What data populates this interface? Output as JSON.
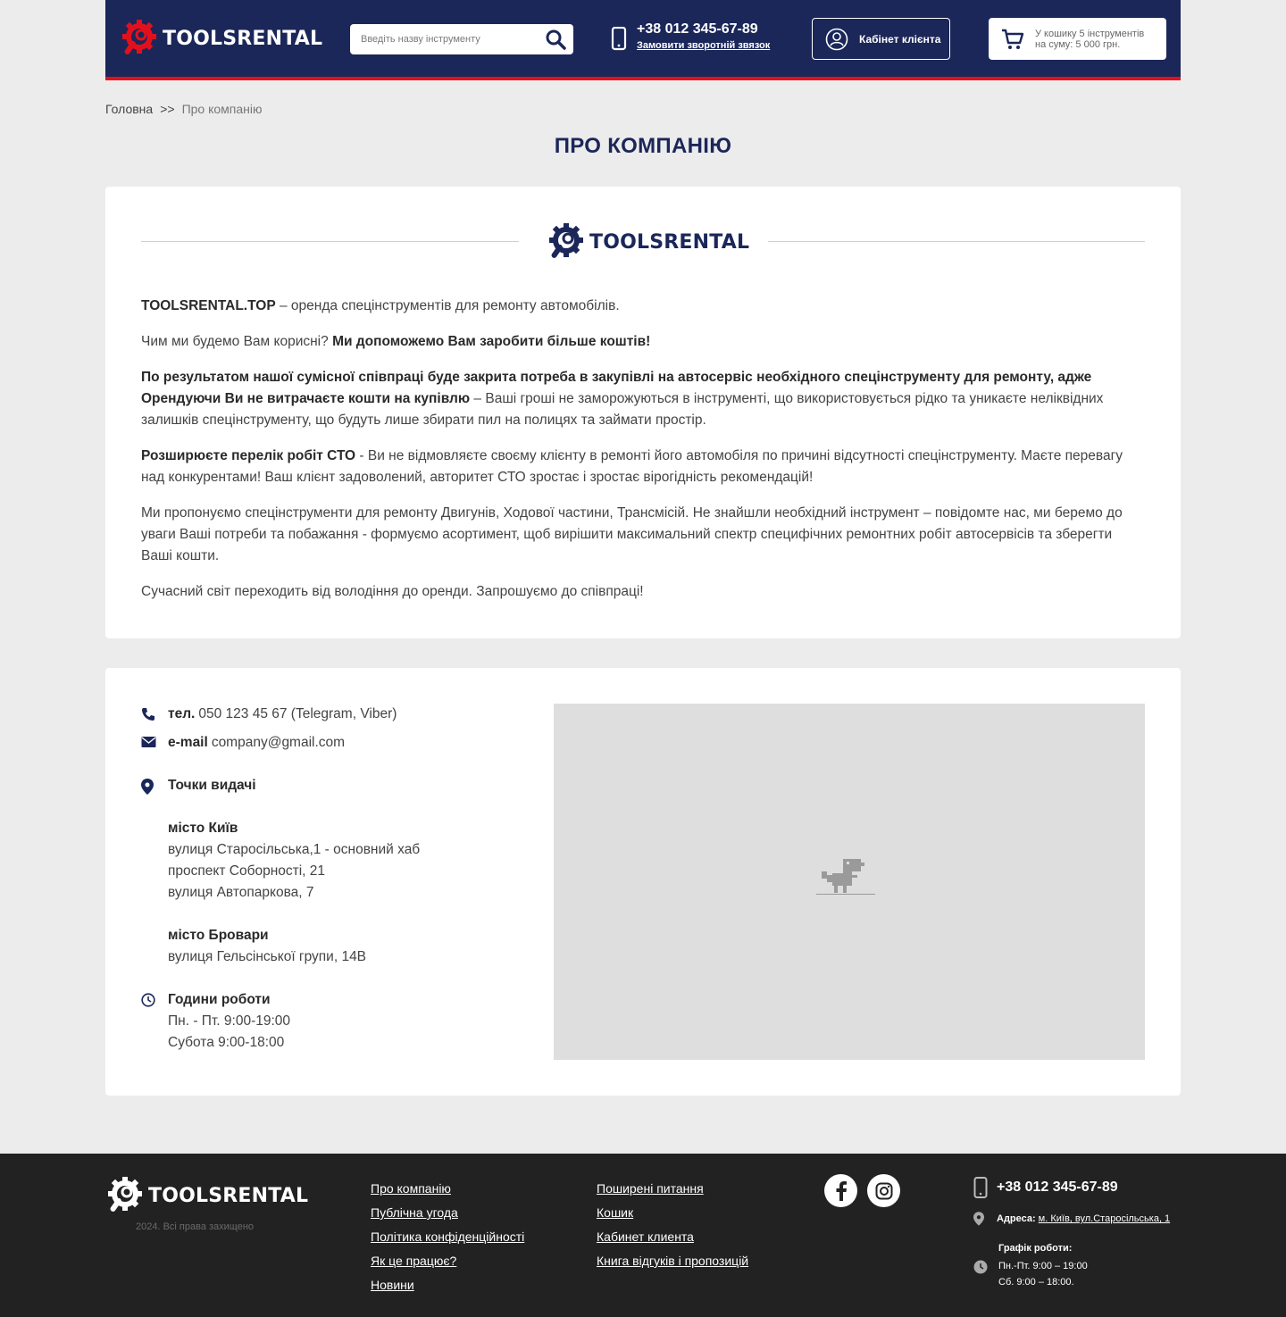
{
  "colors": {
    "brand_navy": "#1b2759",
    "brand_red": "#e3101c",
    "footer_bg": "#222222",
    "page_bg": "#ececec"
  },
  "header": {
    "logo_text": "TOOLSRENTAL",
    "search_placeholder": "Введіть назву інструменту",
    "phone": "+38 012 345-67-89",
    "callback_link": "Замовити зворотній звязок",
    "cabinet_label": "Кабінет клієнта",
    "cart_line1": "У кошику 5 інструментів",
    "cart_line2": "на суму: 5 000 грн."
  },
  "breadcrumb": {
    "home": "Головна",
    "separator": ">>",
    "current": "Про компанію"
  },
  "page_title": "ПРО КОМПАНІЮ",
  "about": {
    "logo_text": "TOOLSRENTAL",
    "p1_bold": "TOOLSRENTAL.TOP",
    "p1_text": " – оренда спецінструментів для ремонту автомобілів.",
    "p2_text": "Чим ми будемо Вам корисні? ",
    "p2_bold": "Ми допоможемо Вам заробити більше коштів!",
    "p3_bold": "По результатом нашої сумісної співпраці буде закрита потреба в закупівлі на автосервіс необхідного спецінструменту для ремонту, адже Орендуючи Ви не витрачаєте кошти на купівлю",
    "p3_text": " – Ваші гроші не заморожуються в інструменті, що використовується рідко та уникаєте неліквідних залишків спецінструменту, що будуть лише збирати пил на полицях та займати простір.",
    "p4_bold": "Розширюєте перелік робіт СТО",
    "p4_text": " - Ви не відмовляєте своєму клієнту в ремонті його автомобіля по причині відсутності спецінструменту. Маєте перевагу над конкурентами! Ваш клієнт задоволений, авторитет СТО зростає і зростає вірогідність рекомендацій!",
    "p5_text": "Ми пропонуємо спецінструменти для ремонту Двигунів, Ходової частини, Трансмісій. Не знайшли необхідний інструмент – повідомте нас, ми беремо до уваги Ваші потреби та побажання - формуємо асортимент, щоб вирішити максимальний спектр специфічних ремонтних робіт автосервісів та зберегти Ваші кошти.",
    "p6_text": "Сучасний світ переходить від володіння до оренди. Запрошуємо до співпраці!"
  },
  "contacts": {
    "tel_label": "тел.",
    "tel_value": "050 123 45 67 (Telegram, Viber)",
    "email_label": "e-mail",
    "email_value": "company@gmail.com",
    "points_label": "Точки видачі",
    "city1": "місто Київ",
    "city1_addresses": [
      "вулиця Старосільська,1 - основний хаб",
      "проспект Соборності, 21",
      "вулиця Автопаркова, 7"
    ],
    "city2": "місто Бровари",
    "city2_addresses": [
      "вулиця Гельсінської групи, 14В"
    ],
    "hours_label": "Години роботи",
    "hours": [
      "Пн. - Пт. 9:00-19:00",
      "Субота 9:00-18:00"
    ]
  },
  "footer": {
    "logo_text": "TOOLSRENTAL",
    "copyright": "2024. Всі права захищено",
    "col1": [
      "Про компанію",
      "Публічна угода",
      "Політика конфіденційності",
      "Як це працює?",
      "Новини"
    ],
    "col2": [
      "Поширені питання",
      "Кошик",
      "Кабинет клиента",
      "Книга відгуків і пропозицій"
    ],
    "phone": "+38 012 345-67-89",
    "address_label": "Адреса:",
    "address_value": "м. Київ, вул.Старосільська, 1",
    "schedule_title": "Графік роботи:",
    "schedule": [
      "Пн.-Пт. 9:00 – 19:00",
      "Сб. 9:00 – 18:00."
    ]
  }
}
